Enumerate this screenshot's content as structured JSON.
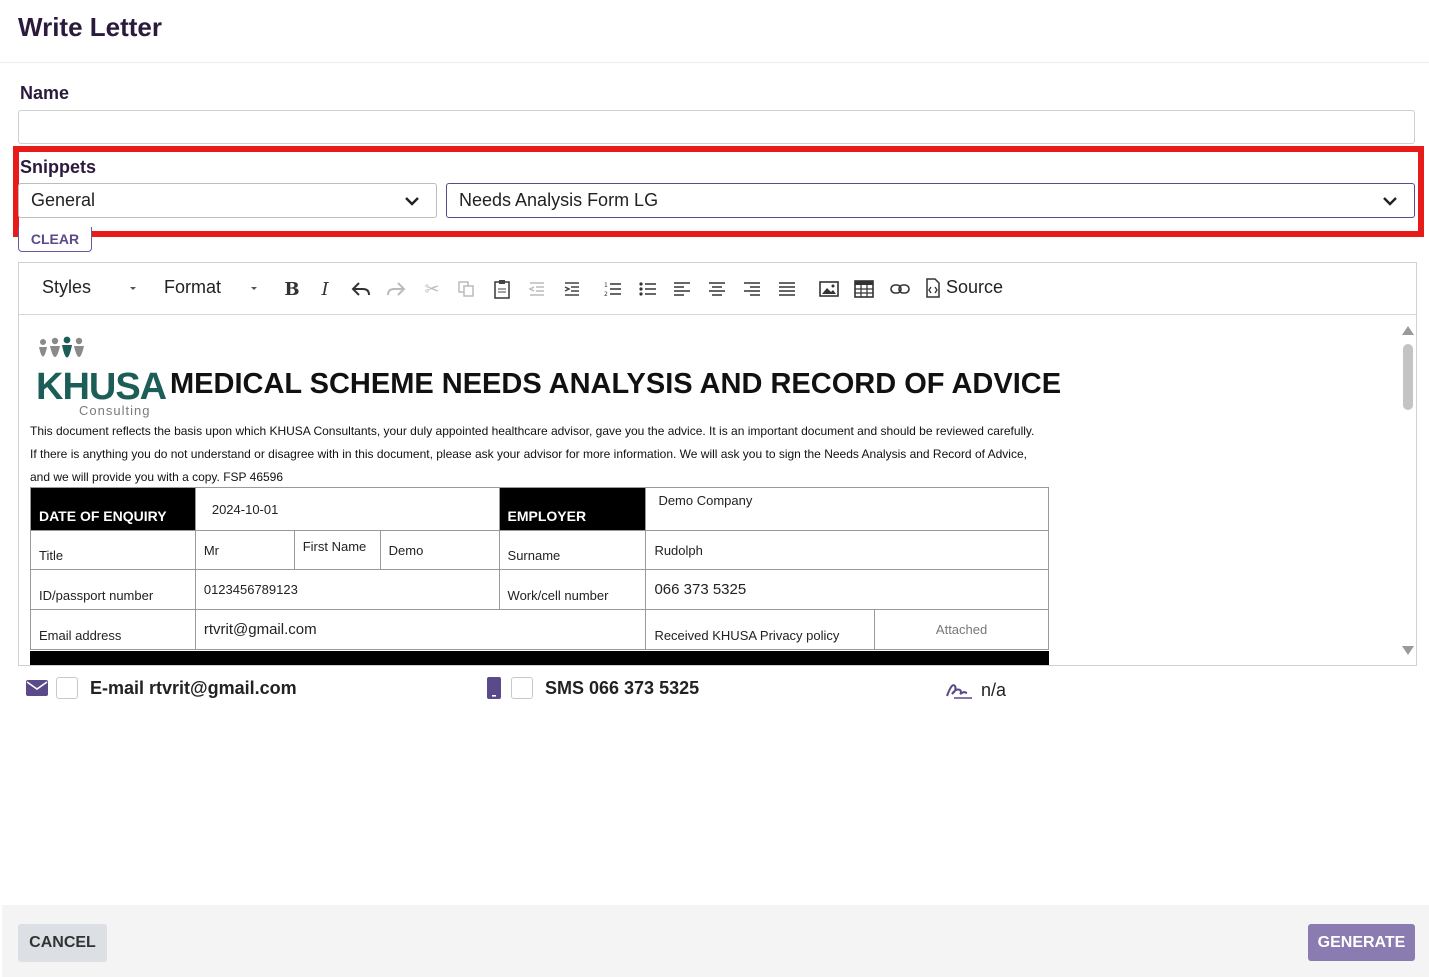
{
  "dialog": {
    "title": "Write Letter"
  },
  "name_field": {
    "label": "Name",
    "value": ""
  },
  "snippets": {
    "label": "Snippets",
    "category_value": "General",
    "snippet_value": "Needs Analysis Form LG",
    "clear_label": "CLEAR"
  },
  "toolbar": {
    "styles_label": "Styles",
    "format_label": "Format",
    "source_label": "Source",
    "icons": [
      "bold-icon",
      "italic-icon",
      "undo-icon",
      "redo-icon",
      "cut-icon",
      "copy-icon",
      "paste-icon",
      "outdent-icon",
      "indent-icon",
      "numbered-list-icon",
      "bulleted-list-icon",
      "align-left-icon",
      "align-center-icon",
      "align-right-icon",
      "justify-icon",
      "image-icon",
      "table-icon",
      "link-icon",
      "source-icon"
    ]
  },
  "document": {
    "logo_text": "KHUSA",
    "logo_sub": "Consulting",
    "heading": "MEDICAL SCHEME NEEDS ANALYSIS AND RECORD OF ADVICE",
    "para1": "This document reflects the basis upon which KHUSA Consultants, your duly appointed healthcare advisor, gave you the advice. It is an important document and should be reviewed carefully.",
    "para2": "If there is anything you do not understand or disagree with in this document, please ask your advisor for more information. We will ask you to sign the Needs Analysis and Record of Advice,",
    "para3": "and we will provide you with a copy. FSP 46596",
    "date_label": "DATE OF ENQUIRY",
    "date_value": "2024-10-01",
    "employer_label": "EMPLOYER",
    "employer_value": "Demo Company",
    "title_label": "Title",
    "title_value": "Mr",
    "first_name_label": "First Name",
    "first_name_value": "Demo",
    "surname_label": "Surname",
    "surname_value": "Rudolph",
    "id_label": "ID/passport number",
    "id_value": "0123456789123",
    "work_label": "Work/cell number",
    "work_value": "066 373 5325",
    "email_label": "Email address",
    "email_value": "rtvrit@gmail.com",
    "privacy_label": "Received KHUSA Privacy policy",
    "privacy_value": "Attached"
  },
  "notifications": {
    "email_text": "E-mail rtvrit@gmail.com",
    "sms_text": "SMS 066 373 5325",
    "signature_text": "n/a"
  },
  "footer": {
    "cancel_label": "CANCEL",
    "generate_label": "GENERATE"
  },
  "colors": {
    "accent": "#5b4a8a",
    "highlight": "#e81b1b",
    "generate_bg": "#8a7bb0",
    "logo_green": "#1d5d57"
  }
}
